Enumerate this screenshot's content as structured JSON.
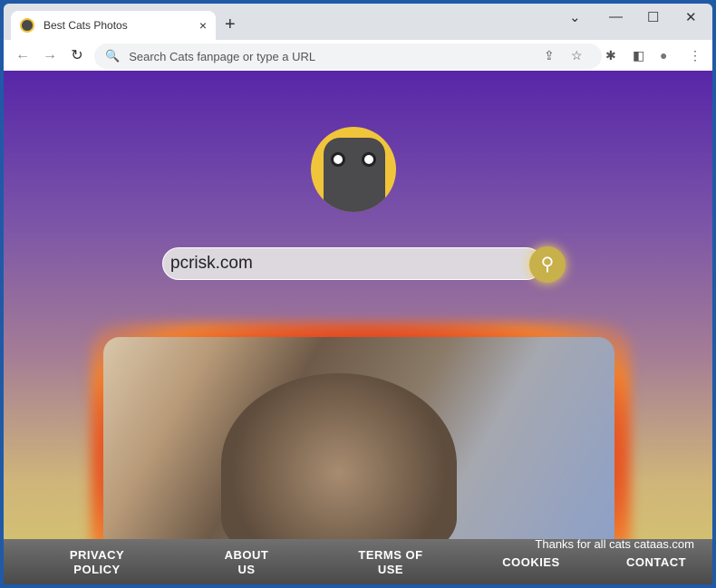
{
  "tab": {
    "title": "Best Cats Photos",
    "close": "×",
    "new_tab": "+"
  },
  "window_controls": {
    "dropdown": "⌄",
    "minimize": "—",
    "maximize": "☐",
    "close": "✕"
  },
  "toolbar": {
    "back": "←",
    "forward": "→",
    "reload": "↻",
    "omnibox_placeholder": "Search Cats fanpage or type a URL",
    "search_icon": "🔍",
    "share": "⇪",
    "star": "☆",
    "extensions": "✱",
    "sidepanel": "◧",
    "profile": "●",
    "menu": "⋮"
  },
  "page": {
    "search_value": "pcrisk.com",
    "search_button": "⚲",
    "footer": {
      "privacy": "PRIVACY POLICY",
      "about": "ABOUT US",
      "terms": "TERMS OF USE",
      "cookies": "COOKIES",
      "contact": "CONTACT",
      "thanks": "Thanks for all cats cataas.com"
    }
  },
  "colors": {
    "frame": "#1f5aa6",
    "gradient_top": "#5726a8",
    "gradient_bottom": "#d6c86c",
    "logo_bg": "#f1c53b"
  }
}
